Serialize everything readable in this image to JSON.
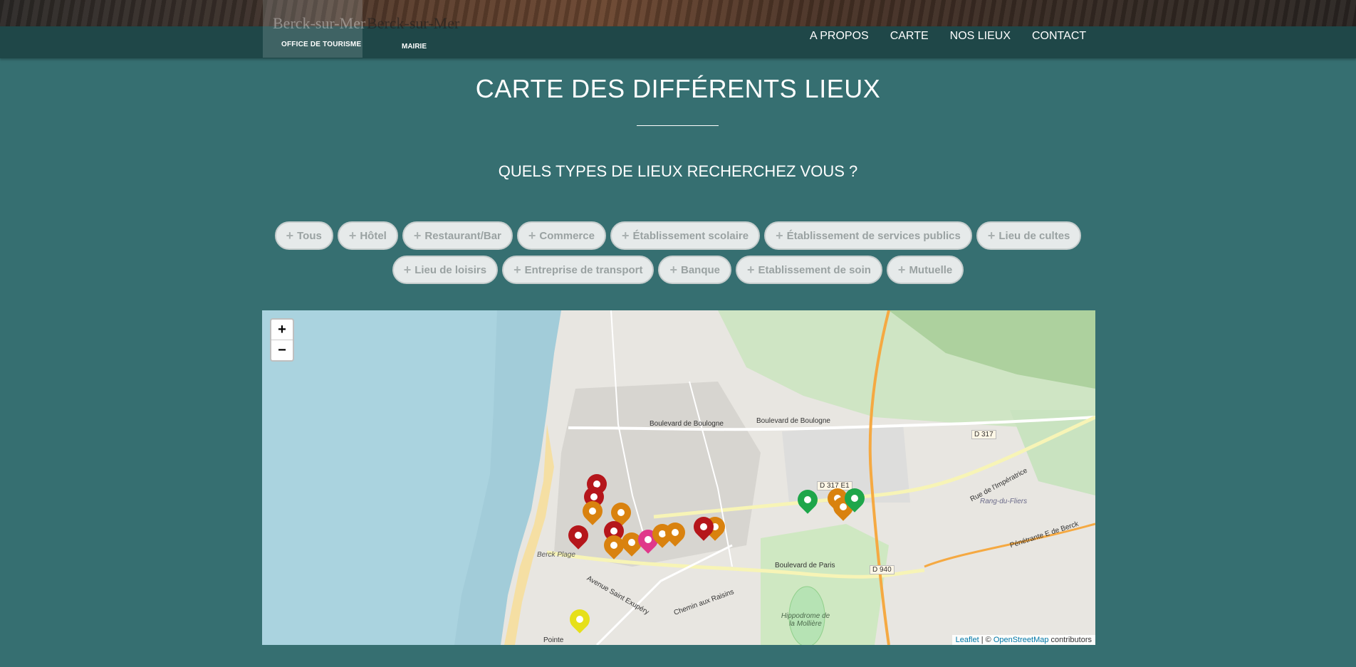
{
  "header": {
    "logo_office": "Berck-sur-Mer",
    "logo_office_sub": "OFFICE DE TOURISME",
    "logo_mairie": "Berck-sur-Mer",
    "logo_mairie_sub": "MAIRIE",
    "nav": [
      "A PROPOS",
      "CARTE",
      "NOS LIEUX",
      "CONTACT"
    ]
  },
  "main": {
    "title": "CARTE DES DIFFÉRENTS LIEUX",
    "subtitle": "QUELS TYPES DE LIEUX RECHERCHEZ VOUS ?",
    "filters": [
      "Tous",
      "Hôtel",
      "Restaurant/Bar",
      "Commerce",
      "Établissement scolaire",
      "Établissement de services publics",
      "Lieu de cultes",
      "Lieu de loisirs",
      "Entreprise de transport",
      "Banque",
      "Etablissement de soin",
      "Mutuelle"
    ]
  },
  "map": {
    "zoom_in": "+",
    "zoom_out": "−",
    "attribution_leaflet": "Leaflet",
    "attribution_sep": " | © ",
    "attribution_osm": "OpenStreetMap",
    "attribution_tail": " contributors",
    "labels": {
      "boulevard_boulogne_1": "Boulevard de Boulogne",
      "boulevard_boulogne_2": "Boulevard de Boulogne",
      "boulevard_paris": "Boulevard de Paris",
      "rue_imperatrice": "Rue de l'Impératrice",
      "penetrante": "Pénétrante E de Berck",
      "rang_du_fliers": "Rang-du-Fliers",
      "hippodrome": "Hippodrome de la Mollière",
      "berck_plage": "Berck Plage",
      "chemin_aux_raisins": "Chemin aux Raisins",
      "avenue_st_exupery": "Avenue Saint Exupéry",
      "pointe": "Pointe",
      "d317": "D 317",
      "d317e1": "D 317 E1",
      "d940": "D 940"
    },
    "colors": {
      "restaurant": "#d9820f",
      "hotel": "#b5161b",
      "public": "#1ea64a",
      "leisure": "#e6e01a",
      "commerce": "#e0388a"
    }
  }
}
